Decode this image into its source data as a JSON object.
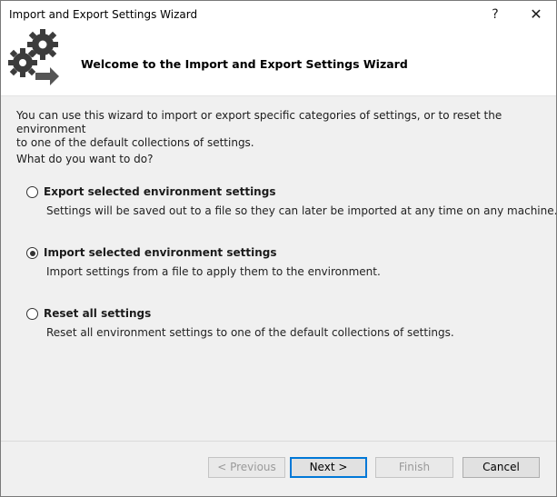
{
  "window": {
    "title": "Import and Export Settings Wizard",
    "help_glyph": "?",
    "close_glyph": "✕"
  },
  "header": {
    "title": "Welcome to the Import and Export Settings Wizard",
    "icon": "gears-arrow-icon"
  },
  "content": {
    "intro_line1": "You can use this wizard to import or export specific categories of settings, or to reset the environment",
    "intro_line2": "to one of the default collections of settings.",
    "question": "What do you want to do?",
    "options": [
      {
        "label": "Export selected environment settings",
        "description": "Settings will be saved out to a file so they can later be imported at any time on any machine.",
        "selected": false
      },
      {
        "label": "Import selected environment settings",
        "description": "Import settings from a file to apply them to the environment.",
        "selected": true
      },
      {
        "label": "Reset all settings",
        "description": "Reset all environment settings to one of the default collections of settings.",
        "selected": false
      }
    ]
  },
  "buttons": {
    "previous": {
      "label": "< Previous",
      "enabled": false
    },
    "next": {
      "label": "Next >",
      "enabled": true
    },
    "finish": {
      "label": "Finish",
      "enabled": false
    },
    "cancel": {
      "label": "Cancel",
      "enabled": true
    }
  }
}
